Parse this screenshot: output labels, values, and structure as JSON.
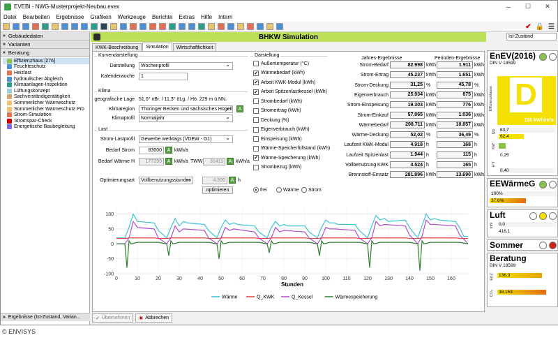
{
  "window": {
    "title": "EVEBI - NWG-Musterprojekt-Neubau.evex"
  },
  "menu": [
    "Datei",
    "Bearbeiten",
    "Ergebnisse",
    "Grafiken",
    "Werkzeuge",
    "Berichte",
    "Extras",
    "Hilfe",
    "Intern"
  ],
  "sidebar": {
    "headers": [
      "Gebäudedaten",
      "Varianten",
      "Beratung"
    ],
    "items": [
      "Effizienzhaus [276]",
      "Feuchteschutz",
      "Heizlast",
      "hydraulischer Abgleich",
      "Klimaanlagen-Inspektion",
      "Lüftungskonzept",
      "Sachverständigentätigkeit",
      "Sommerlicher Wärmeschutz",
      "Sommerlicher Wärmeschutz Pro",
      "Strom-Simulation",
      "Stromspar-Check",
      "Energetische Baubegleitung"
    ],
    "footer": "Ergebnisse (Ist-Zustand, Varian..."
  },
  "main": {
    "title": "BHKW Simulation",
    "tabs": [
      "KWK-Beschreibung",
      "Simulation",
      "Wirtschaftlichkeit"
    ],
    "kurven": {
      "group": "Kurvendarstellung",
      "darstellung_label": "Darstellung",
      "darstellung": "Wochenprofil",
      "kalenderwoche_label": "Kalenderwoche",
      "kalenderwoche": "1"
    },
    "klima": {
      "group": "Klima",
      "lage_label": "geografische Lage",
      "lage": "51,0° nBr. / 11,3° öLg. / Hö. 229 m ü.NN.",
      "region_label": "Klimaregion",
      "region": "Thüringer Becken und sächsisches Hügellan",
      "profil_label": "Klimaprofil",
      "profil": "Normaljahr"
    },
    "last": {
      "group": "Last",
      "strom_last_label": "Strom-Lastprofil",
      "strom_last": "Gewerbe werktags (VDEW - G1)",
      "bedarf_strom_label": "Bedarf Strom",
      "bedarf_strom": "83000",
      "bedarf_strom_unit": "kWh/a",
      "bedarf_waerme_label": "Bedarf Wärme H",
      "bedarf_waerme": "177299",
      "bedarf_waerme_unit": "kWh/a",
      "tww_label": "TWW",
      "tww": "31411",
      "tww_unit": "kWh/a"
    },
    "opt": {
      "label": "Optimierungsart",
      "value": "Vollbenutzungsstunden",
      "hours": "4.500",
      "hours_unit": "h",
      "button": "optimieren"
    },
    "darst": {
      "group": "Darstellung",
      "items": [
        {
          "label": "Außentemperatur (°C)",
          "checked": false
        },
        {
          "label": "Wärmebedarf (kWh)",
          "checked": true
        },
        {
          "label": "Arbeit KWK-Modul (kWh)",
          "checked": true
        },
        {
          "label": "Arbeit Spitzenlastkessel (kWh)",
          "checked": true
        },
        {
          "label": "Strombedarf (kWh)",
          "checked": false
        },
        {
          "label": "Stromertrag (kWh)",
          "checked": false
        },
        {
          "label": "Deckung (%)",
          "checked": false
        },
        {
          "label": "Eigenverbrauch (kWh)",
          "checked": false
        },
        {
          "label": "Einspeisung (kWh)",
          "checked": false
        },
        {
          "label": "Wärme-Speicherfüllstand (kWh)",
          "checked": false
        },
        {
          "label": "Wärme-Speicherung (kWh)",
          "checked": true
        },
        {
          "label": "Strombezug (kWh)",
          "checked": false
        }
      ],
      "radios": [
        "frei",
        "Wärme",
        "Strom"
      ]
    },
    "results": {
      "jahres_title": "Jahres-Ergebnisse",
      "perioden_title": "Perioden-Ergebnisse",
      "rows": [
        {
          "label": "Strom-Bedarf",
          "jahr": "82.998",
          "p": "1.911",
          "unit": "kWh"
        },
        {
          "label": "Strom-Ertrag",
          "jahr": "45.237",
          "p": "1.651",
          "unit": "kWh"
        },
        {
          "label": "Strom-Deckung",
          "jahr": "31,25",
          "p": "45,78",
          "unit": "%"
        },
        {
          "label": "Eigenverbrauch",
          "jahr": "25.934",
          "p": "875",
          "unit": "kWh"
        },
        {
          "label": "Strom-Einspeisung",
          "jahr": "19.303",
          "p": "776",
          "unit": "kWh"
        },
        {
          "label": "Strom-Einkauf",
          "jahr": "57.065",
          "p": "1.036",
          "unit": "kWh"
        },
        {
          "label": "Wärmebedarf",
          "jahr": "208.711",
          "p": "10.857",
          "unit": "kWh"
        },
        {
          "label": "Wärme-Deckung",
          "jahr": "52,02",
          "p": "36,49",
          "unit": "%"
        },
        {
          "label": "Laufzeit KWK-Modul",
          "jahr": "4.918",
          "p": "168",
          "unit": "h"
        },
        {
          "label": "Laufzeit Spitzenlast",
          "jahr": "1.944",
          "p": "115",
          "unit": "h"
        },
        {
          "label": "Vollbenutzung KWK",
          "jahr": "4.524",
          "p": "165",
          "unit": "h"
        },
        {
          "label": "Brennstoff-Einsatz",
          "jahr": "281.896",
          "p": "13.690",
          "unit": "kWh"
        }
      ],
      "jahr_units": [
        "kWh",
        "kWh",
        "%",
        "kWh",
        "kWh",
        "kWh",
        "kWh",
        "%",
        "h",
        "h",
        "h",
        "kWh"
      ]
    },
    "buttons": {
      "apply": "Übernehmen",
      "cancel": "Abbrechen"
    }
  },
  "chart_data": {
    "type": "line",
    "xlabel": "Stunden",
    "xlim": [
      0,
      168
    ],
    "ylim": [
      -100,
      120
    ],
    "xticks": [
      0,
      10,
      20,
      30,
      40,
      50,
      60,
      70,
      80,
      90,
      100,
      110,
      120,
      130,
      140,
      150,
      160
    ],
    "yticks": [
      100,
      50,
      0,
      -50,
      -100
    ],
    "series": [
      {
        "name": "Wärme",
        "color": "#3cc3d6",
        "x": [
          0,
          4,
          6,
          8,
          10,
          18,
          20,
          24,
          26,
          28,
          30,
          32,
          34,
          42,
          44,
          48,
          50,
          52,
          54,
          56,
          58,
          66,
          68,
          72,
          74,
          76,
          78,
          80,
          82,
          90,
          92,
          96,
          98,
          100,
          102,
          104,
          106,
          114,
          116,
          120,
          122,
          124,
          126,
          128,
          130,
          138,
          140,
          144,
          146,
          148,
          150,
          152,
          154,
          162,
          164,
          166,
          168
        ],
        "values": [
          20,
          20,
          55,
          100,
          75,
          70,
          45,
          20,
          55,
          85,
          60,
          75,
          70,
          65,
          45,
          20,
          55,
          80,
          65,
          70,
          65,
          60,
          40,
          20,
          55,
          75,
          60,
          65,
          60,
          60,
          40,
          20,
          55,
          80,
          70,
          70,
          65,
          65,
          45,
          20,
          60,
          95,
          80,
          85,
          75,
          80,
          55,
          20,
          60,
          100,
          80,
          85,
          80,
          75,
          55,
          25,
          25
        ]
      },
      {
        "name": "Q_KWK",
        "color": "#e0453e",
        "x": [
          0,
          4,
          6,
          8,
          18,
          20,
          24,
          26,
          28,
          42,
          44,
          48,
          50,
          52,
          66,
          68,
          72,
          74,
          76,
          90,
          92,
          96,
          98,
          100,
          114,
          116,
          120,
          122,
          124,
          138,
          140,
          144,
          146,
          148,
          162,
          164,
          168
        ],
        "values": [
          18,
          18,
          20,
          20,
          20,
          18,
          18,
          20,
          20,
          20,
          18,
          18,
          20,
          20,
          20,
          18,
          18,
          20,
          20,
          20,
          18,
          18,
          20,
          20,
          20,
          18,
          18,
          20,
          20,
          20,
          18,
          18,
          20,
          20,
          20,
          18,
          18
        ]
      },
      {
        "name": "Q_Kessel",
        "color": "#b14ec9",
        "x": [
          0,
          4,
          6,
          8,
          10,
          18,
          20,
          24,
          26,
          28,
          30,
          32,
          42,
          44,
          48,
          50,
          52,
          54,
          56,
          66,
          68,
          72,
          74,
          76,
          78,
          80,
          90,
          92,
          96,
          98,
          100,
          102,
          104,
          114,
          116,
          120,
          122,
          124,
          126,
          128,
          138,
          140,
          144,
          146,
          148,
          150,
          152,
          162,
          164,
          168
        ],
        "values": [
          0,
          0,
          20,
          75,
          55,
          50,
          20,
          0,
          20,
          60,
          40,
          50,
          45,
          20,
          0,
          20,
          55,
          45,
          50,
          40,
          20,
          0,
          20,
          55,
          40,
          45,
          40,
          20,
          0,
          20,
          55,
          50,
          50,
          45,
          20,
          0,
          20,
          75,
          60,
          65,
          60,
          30,
          0,
          25,
          80,
          65,
          65,
          60,
          30,
          0
        ]
      },
      {
        "name": "Wärmespeicherung",
        "color": "#2e7d32",
        "x": [
          0,
          4,
          5,
          6,
          7,
          10,
          20,
          24,
          25,
          26,
          27,
          30,
          44,
          48,
          49,
          50,
          51,
          54,
          68,
          72,
          73,
          74,
          75,
          78,
          92,
          96,
          97,
          98,
          99,
          102,
          116,
          120,
          121,
          122,
          123,
          126,
          140,
          144,
          145,
          146,
          147,
          150,
          164,
          168
        ],
        "values": [
          0,
          0,
          -80,
          10,
          0,
          5,
          5,
          0,
          -40,
          10,
          0,
          5,
          5,
          0,
          -50,
          10,
          0,
          5,
          5,
          0,
          -30,
          10,
          0,
          5,
          5,
          0,
          -40,
          10,
          0,
          5,
          5,
          0,
          -80,
          10,
          0,
          5,
          5,
          0,
          -90,
          10,
          0,
          5,
          5,
          0
        ]
      }
    ]
  },
  "rightpanel": {
    "zustand": "Ist-Zustand",
    "enev": {
      "title": "EnEV(2016)",
      "sub": "DIN V 18599",
      "grade": "D",
      "value": "116 kWh/m²a",
      "qp_label": "Qp",
      "qp1": "83,7",
      "qp2": "62,4",
      "kw_label": "KW",
      "kw": "0,25",
      "ht_label": "H'T",
      "ht": "0,40",
      "effizienz": "Effizienzklasse"
    },
    "eew": {
      "title": "EEWärmeG",
      "v1": "100%",
      "v2": "37,6%"
    },
    "luft": {
      "title": "Luft",
      "inf_label": "Infil",
      "v1": "0,0",
      "v2": "416,1"
    },
    "sommer": {
      "title": "Sommer"
    },
    "beratung": {
      "title": "Beratung",
      "sub": "DIN V 18599",
      "ekz_label": "EKZ",
      "ekz": "136,3",
      "co2_label": "CO₂",
      "co2": "38.153"
    },
    "colors": {
      "green": "#8bc34a",
      "yellow": "#f4e100",
      "red": "#d0201c"
    }
  },
  "footer": {
    "copyright": "© ENVISYS"
  }
}
